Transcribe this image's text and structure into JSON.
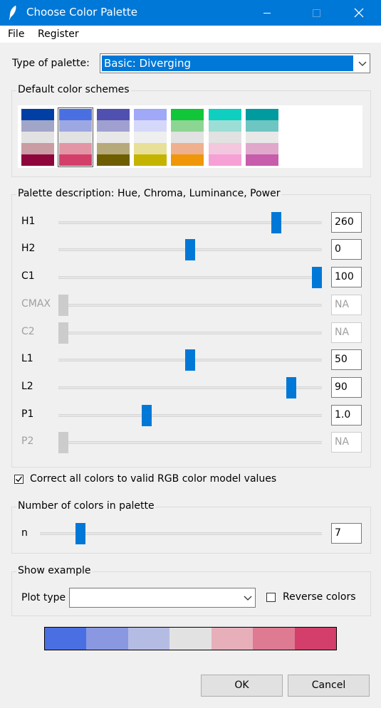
{
  "window": {
    "title": "Choose Color Palette"
  },
  "menu": {
    "items": [
      "File",
      "Register"
    ]
  },
  "palette_type": {
    "label": "Type of palette:",
    "value": "Basic: Diverging"
  },
  "default_schemes": {
    "title": "Default color schemes",
    "schemes": [
      {
        "colors": [
          "#023FA5",
          "#A1A6C8",
          "#E2E2E2",
          "#CA9CA4",
          "#8E063B"
        ],
        "selected": false
      },
      {
        "colors": [
          "#4A6FE3",
          "#9DA8E2",
          "#E2E2E2",
          "#E495A5",
          "#D33F6A"
        ],
        "selected": true
      },
      {
        "colors": [
          "#5050B0",
          "#A0A0D0",
          "#E8E8E8",
          "#B6A97A",
          "#6E5E00"
        ],
        "selected": false
      },
      {
        "colors": [
          "#A0A8F8",
          "#D6D8FA",
          "#EFEFEF",
          "#E8E098",
          "#C4B400"
        ],
        "selected": false
      },
      {
        "colors": [
          "#11C638",
          "#8DD593",
          "#E2E2E2",
          "#EFB08E",
          "#EF9708"
        ],
        "selected": false
      },
      {
        "colors": [
          "#0FCFC0",
          "#9CDED6",
          "#E2E2E2",
          "#F3C7DE",
          "#F7A0D6"
        ],
        "selected": false
      },
      {
        "colors": [
          "#009B9F",
          "#6EC6C3",
          "#E8E8E8",
          "#E0A8CB",
          "#C75DAB"
        ],
        "selected": false
      }
    ]
  },
  "description": {
    "title": "Palette description: Hue, Chroma, Luminance, Power",
    "sliders": [
      {
        "label": "H1",
        "value": "260",
        "position": 0.84,
        "enabled": true
      },
      {
        "label": "H2",
        "value": "0",
        "position": 0.5,
        "enabled": true
      },
      {
        "label": "C1",
        "value": "100",
        "position": 1.0,
        "enabled": true
      },
      {
        "label": "CMAX",
        "value": "NA",
        "position": 0.0,
        "enabled": false
      },
      {
        "label": "C2",
        "value": "NA",
        "position": 0.0,
        "enabled": false
      },
      {
        "label": "L1",
        "value": "50",
        "position": 0.5,
        "enabled": true
      },
      {
        "label": "L2",
        "value": "90",
        "position": 0.9,
        "enabled": true
      },
      {
        "label": "P1",
        "value": "1.0",
        "position": 0.33,
        "enabled": true
      },
      {
        "label": "P2",
        "value": "NA",
        "position": 0.0,
        "enabled": false
      }
    ]
  },
  "correct_colors": {
    "label": "Correct all colors to valid RGB color model values",
    "checked": true
  },
  "num_colors": {
    "title": "Number of colors in palette",
    "label": "n",
    "value": "7",
    "position": 0.13
  },
  "example": {
    "title": "Show example",
    "plot_type_label": "Plot type",
    "plot_type_value": "",
    "reverse_label": "Reverse colors",
    "reverse_checked": false
  },
  "palette_preview": [
    "#4A6FE3",
    "#8A98E2",
    "#B5BCE3",
    "#E2E2E2",
    "#E6AFBA",
    "#DE7A92",
    "#D33F6A"
  ],
  "buttons": {
    "ok": "OK",
    "cancel": "Cancel"
  }
}
